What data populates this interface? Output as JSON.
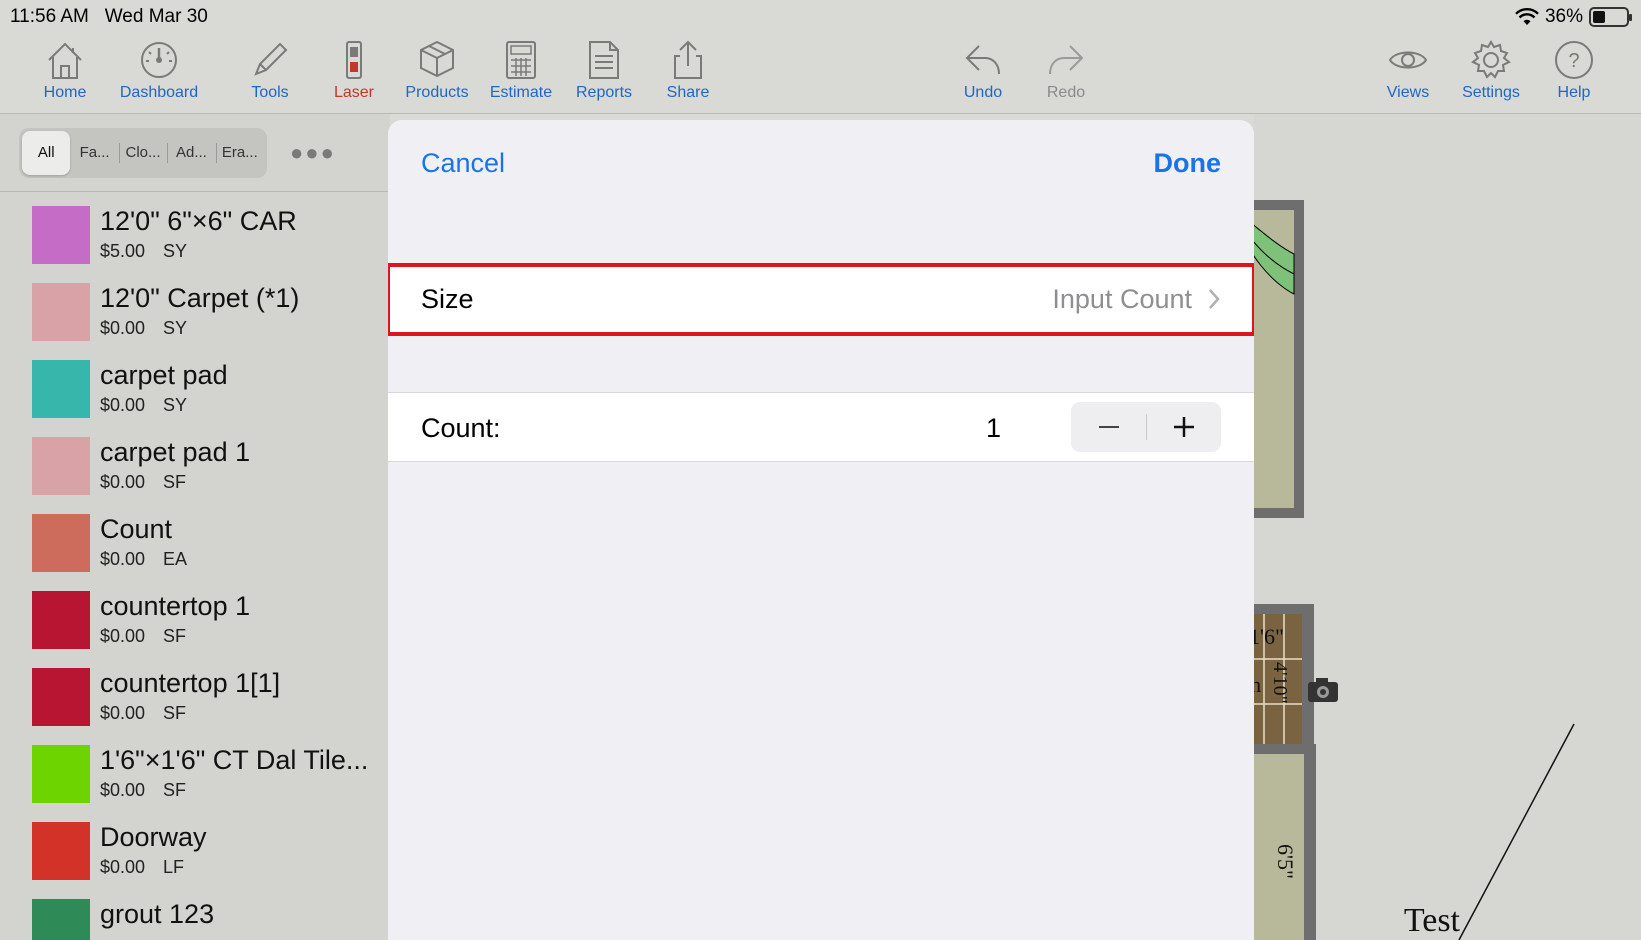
{
  "status_bar": {
    "time": "11:56 AM",
    "date": "Wed Mar 30",
    "battery": "36%"
  },
  "toolbar": {
    "home": "Home",
    "dashboard": "Dashboard",
    "tools": "Tools",
    "laser": "Laser",
    "products": "Products",
    "estimate": "Estimate",
    "reports": "Reports",
    "share": "Share",
    "undo": "Undo",
    "redo": "Redo",
    "views": "Views",
    "settings": "Settings",
    "help": "Help"
  },
  "filter_tabs": [
    "All",
    "Fa...",
    "Clo...",
    "Ad...",
    "Era..."
  ],
  "products": [
    {
      "name": "12'0\" 6\"×6\" CAR",
      "price": "$5.00",
      "unit": "SY",
      "color": "#c46cc6"
    },
    {
      "name": "12'0\" Carpet  (*1)",
      "price": "$0.00",
      "unit": "SY",
      "color": "#d8a2a6"
    },
    {
      "name": "carpet pad",
      "price": "$0.00",
      "unit": "SY",
      "color": "#37b7ac"
    },
    {
      "name": "carpet pad 1",
      "price": "$0.00",
      "unit": "SF",
      "color": "#d8a2a6"
    },
    {
      "name": "Count",
      "price": "$0.00",
      "unit": "EA",
      "color": "#cd6b5c"
    },
    {
      "name": "countertop 1",
      "price": "$0.00",
      "unit": "SF",
      "color": "#b71532"
    },
    {
      "name": "countertop 1[1]",
      "price": "$0.00",
      "unit": "SF",
      "color": "#b71532"
    },
    {
      "name": "1'6\"×1'6\" CT Dal Tile...",
      "price": "$0.00",
      "unit": "SF",
      "color": "#6ed400"
    },
    {
      "name": "Doorway",
      "price": "$0.00",
      "unit": "LF",
      "color": "#d23228"
    },
    {
      "name": "grout 123",
      "price": "",
      "unit": "",
      "color": "#2e8b57"
    }
  ],
  "modal": {
    "cancel": "Cancel",
    "done": "Done",
    "size_label": "Size",
    "size_value": "Input Count",
    "count_label": "Count:",
    "count_value": "1"
  },
  "canvas": {
    "dim1": "1'6\"",
    "dim2": "4'10\"",
    "room_label": "th",
    "dim3": "6'5\"",
    "text": "Test"
  }
}
